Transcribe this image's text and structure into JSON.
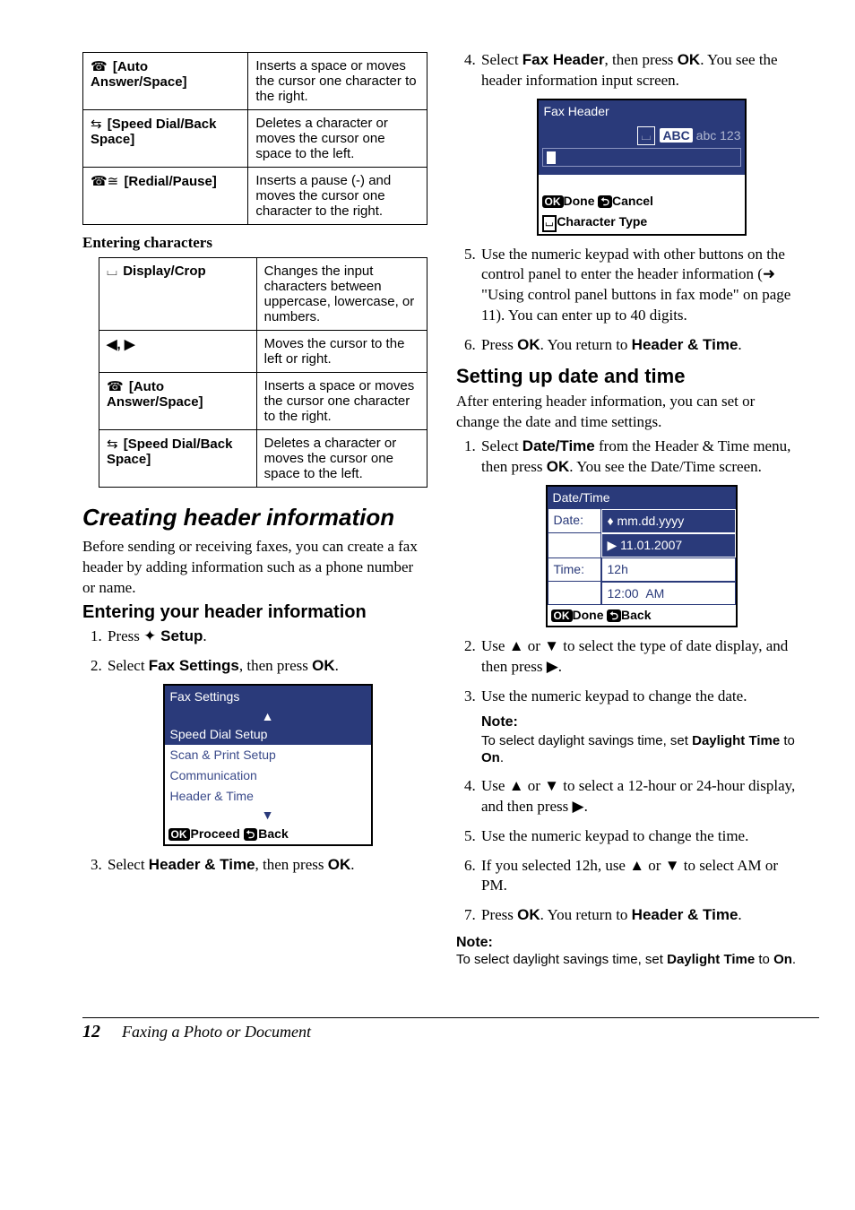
{
  "tables": {
    "phone": [
      {
        "icon": "☎",
        "label": "[Auto Answer/Space]",
        "desc": "Inserts a space or moves the cursor one character to the right."
      },
      {
        "icon": "⇆",
        "label": "[Speed Dial/Back Space]",
        "desc": "Deletes a character or moves the cursor one space to the left."
      },
      {
        "icon": "☎≅",
        "label": "[Redial/Pause]",
        "desc": "Inserts a pause (-) and moves the cursor one character to the right."
      }
    ],
    "chars_heading": "Entering characters",
    "chars": [
      {
        "icon": "⌴",
        "label": "Display/Crop",
        "desc": "Changes the input characters between uppercase, lowercase, or numbers."
      },
      {
        "icon": "",
        "label": "◀, ▶",
        "desc": "Moves the cursor to the left or right."
      },
      {
        "icon": "☎",
        "label": "[Auto Answer/Space]",
        "desc": "Inserts a space or moves the cursor one character to the right."
      },
      {
        "icon": "⇆",
        "label": "[Speed Dial/Back Space]",
        "desc": "Deletes a character or moves the cursor one space to the left."
      }
    ]
  },
  "left": {
    "h2": "Creating header information",
    "intro": "Before sending or receiving faxes, you can create a fax header by adding information such as a phone number or name.",
    "h3": "Entering your header information",
    "step1_pre": "Press ",
    "step1_icon": "✦",
    "step1_bold": " Setup",
    "step1_post": ".",
    "step2_pre": "Select ",
    "step2_bold": "Fax Settings",
    "step2_mid": ", then press ",
    "step2_bold2": "OK",
    "step2_post": ".",
    "step3_pre": "Select ",
    "step3_bold": "Header & Time",
    "step3_mid": ", then press ",
    "step3_bold2": "OK",
    "step3_post": "."
  },
  "shot1": {
    "title": "Fax Settings",
    "rows": [
      "Speed Dial Setup",
      "Scan & Print Setup",
      "Communication",
      "Header & Time"
    ],
    "ftr_ok": "OK",
    "ftr_proceed": "Proceed",
    "ftr_back": "Back"
  },
  "right": {
    "s4_pre": "Select ",
    "s4_b1": "Fax Header",
    "s4_mid": ", then press ",
    "s4_b2": "OK",
    "s4_post": ". You see the header information input screen.",
    "s5": "Use the numeric keypad with other buttons on the control panel to enter the header information (➜ \"Using control panel buttons in fax mode\" on page 11). You can enter up to 40 digits.",
    "s6_pre": "Press ",
    "s6_b1": "OK",
    "s6_mid": ". You return to ",
    "s6_b2": "Header & Time",
    "s6_post": ".",
    "h3": "Setting up date and time",
    "intro": "After entering header information, you can set or change the date and time settings.",
    "d1_pre": "Select ",
    "d1_b1": "Date/Time",
    "d1_mid": " from the Header & Time menu, then press ",
    "d1_b2": "OK",
    "d1_post": ". You see the Date/Time screen.",
    "d2": "Use ▲ or ▼ to select the type of date display, and then press ▶.",
    "d3": "Use the numeric keypad to change the date.",
    "note_h": "Note:",
    "note1_pre": "To select daylight savings time, set ",
    "note1_b1": "Daylight Time",
    "note1_mid": " to ",
    "note1_b2": "On",
    "note1_post": ".",
    "d4": "Use ▲ or ▼ to select a 12-hour or 24-hour display, and then press ▶.",
    "d5": "Use the numeric keypad to change the time.",
    "d6": "If you selected 12h, use ▲ or ▼ to select AM or PM.",
    "d7_pre": "Press ",
    "d7_b1": "OK",
    "d7_mid": ". You return to ",
    "d7_b2": "Header & Time",
    "d7_post": "."
  },
  "shot2": {
    "title": "Fax Header",
    "abc": "ABC",
    "abc_rest": " abc 123",
    "done": "Done",
    "cancel": "Cancel",
    "chartype": "Character Type",
    "ok": "OK",
    "icon": "⌴"
  },
  "shot3": {
    "title": "Date/Time",
    "date_lbl": "Date:",
    "date_fmt": "♦ mm.dd.yyyy",
    "date_val": "▶ 11.01.2007",
    "time_lbl": "Time:",
    "hr": "12h",
    "time_val": "12:00",
    "ampm": "AM",
    "ok": "OK",
    "done": "Done",
    "back": "Back"
  },
  "footer": {
    "page": "12",
    "title": "Faxing a Photo or Document"
  }
}
